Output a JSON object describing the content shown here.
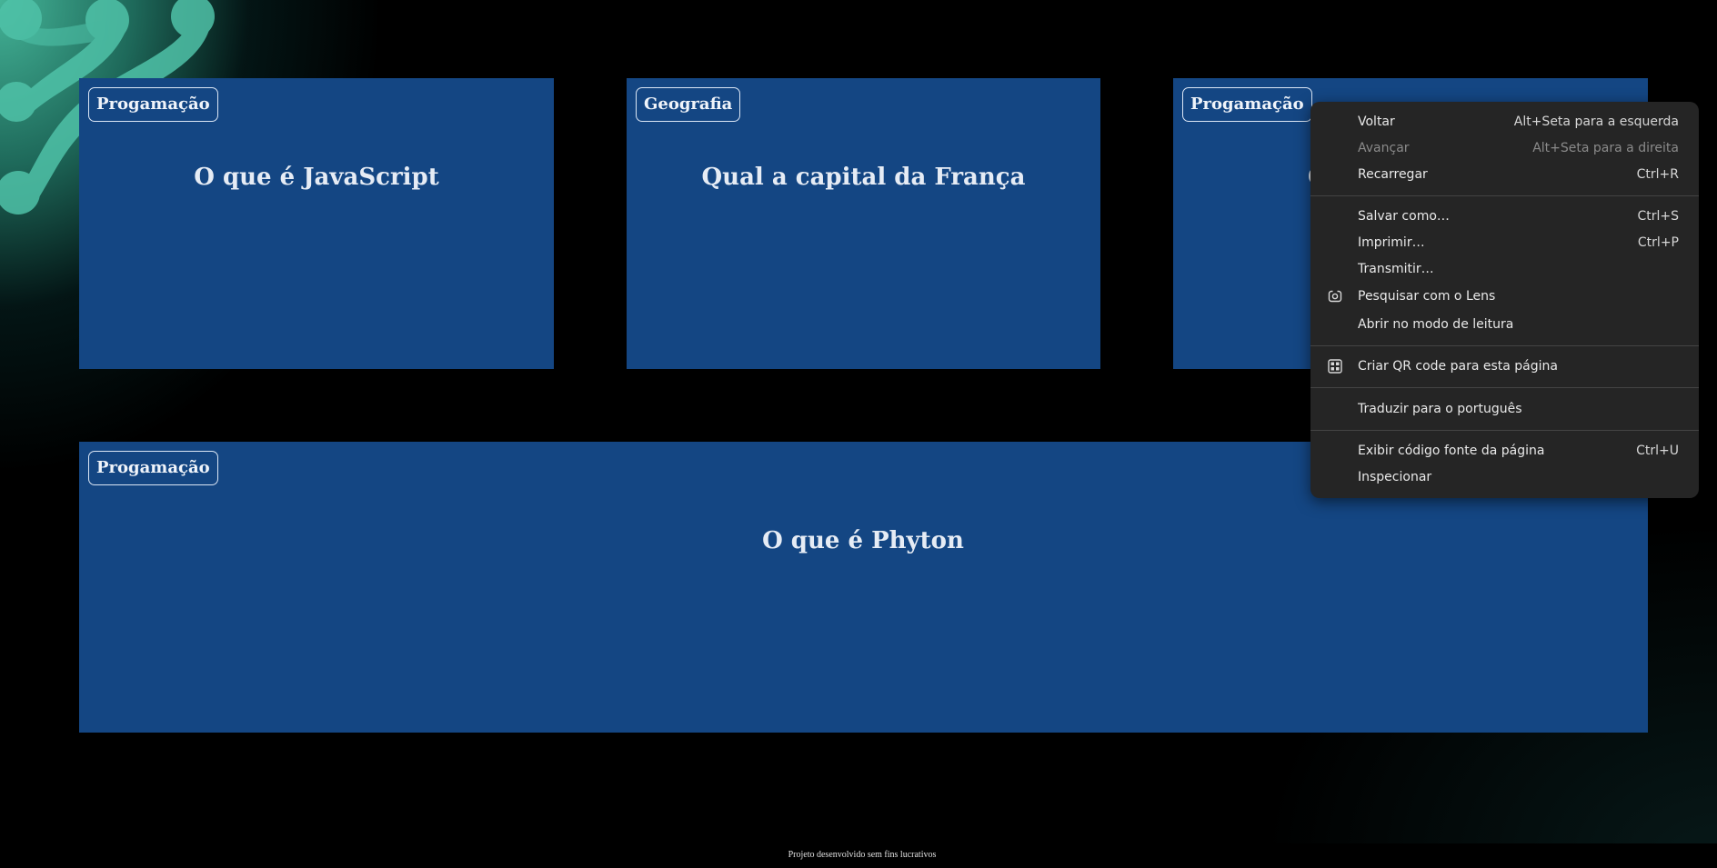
{
  "cards": [
    {
      "tag": "Progamação",
      "title": "O que é JavaScript"
    },
    {
      "tag": "Geografia",
      "title": "Qual a capital da França"
    },
    {
      "tag": "Progamação",
      "title": "O"
    },
    {
      "tag": "Progamação",
      "title": "O que é Phyton"
    }
  ],
  "footer": {
    "text": "Projeto desenvolvido sem fins lucrativos"
  },
  "context_menu": {
    "items": [
      {
        "label": "Voltar",
        "shortcut": "Alt+Seta para a esquerda"
      },
      {
        "label": "Avançar",
        "shortcut": "Alt+Seta para a direita",
        "disabled": true
      },
      {
        "label": "Recarregar",
        "shortcut": "Ctrl+R"
      },
      {
        "label": "Salvar como…",
        "shortcut": "Ctrl+S"
      },
      {
        "label": "Imprimir…",
        "shortcut": "Ctrl+P"
      },
      {
        "label": "Transmitir…",
        "shortcut": ""
      },
      {
        "label": "Pesquisar com o Lens",
        "shortcut": "",
        "icon": "lens-icon"
      },
      {
        "label": "Abrir no modo de leitura",
        "shortcut": ""
      },
      {
        "label": "Criar QR code para esta página",
        "shortcut": "",
        "icon": "qr-code-icon"
      },
      {
        "label": "Traduzir para o português",
        "shortcut": ""
      },
      {
        "label": "Exibir código fonte da página",
        "shortcut": "Ctrl+U"
      },
      {
        "label": "Inspecionar",
        "shortcut": ""
      }
    ]
  },
  "colors": {
    "card_background": "#144683",
    "menu_background": "#252525",
    "accent_teal": "#48bea0"
  }
}
